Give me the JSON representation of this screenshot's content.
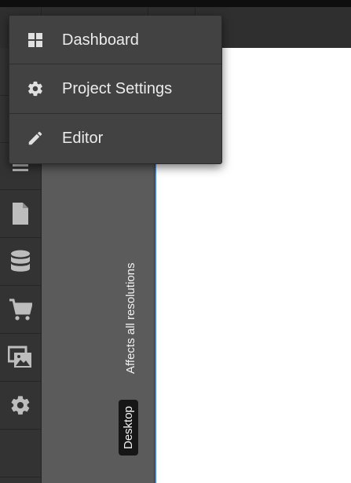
{
  "menu": {
    "items": [
      {
        "label": "Dashboard",
        "icon": "dashboard-icon"
      },
      {
        "label": "Project Settings",
        "icon": "gear-icon"
      },
      {
        "label": "Editor",
        "icon": "pencil-icon"
      }
    ]
  },
  "sidebar": {
    "icons": [
      "list-icon",
      "page-icon",
      "database-icon",
      "cart-icon",
      "media-icon",
      "settings-icon"
    ]
  },
  "panel": {
    "resolution_label": "Affects all resolutions",
    "breakpoint": "Desktop"
  },
  "colors": {
    "canvas_border": "#3d7fd2",
    "menu_bg": "#424242"
  }
}
